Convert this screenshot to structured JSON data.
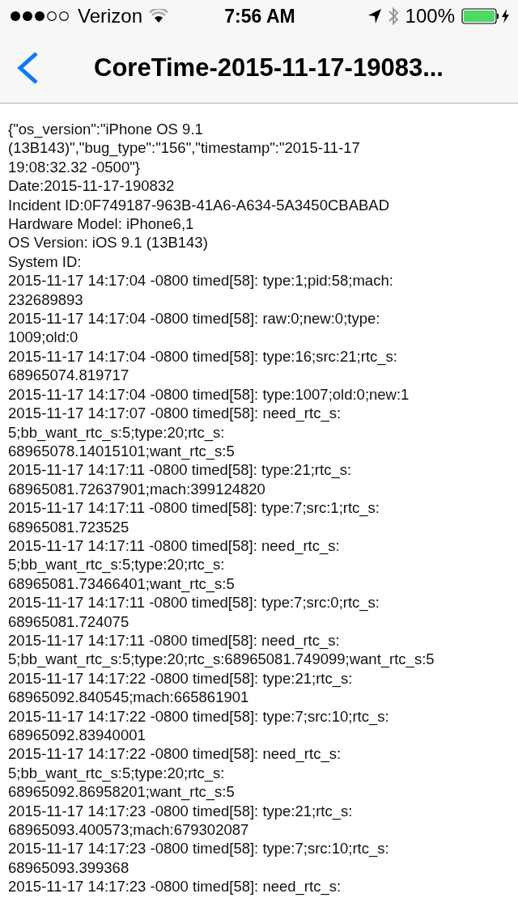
{
  "status_bar": {
    "carrier": "Verizon",
    "time": "7:56 AM",
    "battery": "100%"
  },
  "nav_bar": {
    "title": "CoreTime-2015-11-17-19083..."
  },
  "log_lines": [
    "{\"os_version\":\"iPhone OS 9.1",
    "(13B143)\",\"bug_type\":\"156\",\"timestamp\":\"2015-11-17",
    "19:08:32.32 -0500\"}",
    "Date:2015-11-17-190832",
    "Incident ID:0F749187-963B-41A6-A634-5A3450CBABAD",
    "Hardware Model: iPhone6,1",
    "OS Version: iOS 9.1 (13B143)",
    "System ID:",
    "2015-11-17 14:17:04 -0800 timed[58]: type:1;pid:58;mach:",
    "232689893",
    "2015-11-17 14:17:04 -0800 timed[58]: raw:0;new:0;type:",
    "1009;old:0",
    "2015-11-17 14:17:04 -0800 timed[58]: type:16;src:21;rtc_s:",
    "68965074.819717",
    "2015-11-17 14:17:04 -0800 timed[58]: type:1007;old:0;new:1",
    "2015-11-17 14:17:07 -0800 timed[58]: need_rtc_s:",
    "5;bb_want_rtc_s:5;type:20;rtc_s:",
    "68965078.14015101;want_rtc_s:5",
    "2015-11-17 14:17:11 -0800 timed[58]: type:21;rtc_s:",
    "68965081.72637901;mach:399124820",
    "2015-11-17 14:17:11 -0800 timed[58]: type:7;src:1;rtc_s:",
    "68965081.723525",
    "2015-11-17 14:17:11 -0800 timed[58]: need_rtc_s:",
    "5;bb_want_rtc_s:5;type:20;rtc_s:",
    "68965081.73466401;want_rtc_s:5",
    "2015-11-17 14:17:11 -0800 timed[58]: type:7;src:0;rtc_s:",
    "68965081.724075",
    "2015-11-17 14:17:11 -0800 timed[58]: need_rtc_s:",
    "5;bb_want_rtc_s:5;type:20;rtc_s:68965081.749099;want_rtc_s:5",
    "2015-11-17 14:17:22 -0800 timed[58]: type:21;rtc_s:",
    "68965092.840545;mach:665861901",
    "2015-11-17 14:17:22 -0800 timed[58]: type:7;src:10;rtc_s:",
    "68965092.83940001",
    "2015-11-17 14:17:22 -0800 timed[58]: need_rtc_s:",
    "5;bb_want_rtc_s:5;type:20;rtc_s:",
    "68965092.86958201;want_rtc_s:5",
    "2015-11-17 14:17:23 -0800 timed[58]: type:21;rtc_s:",
    "68965093.400573;mach:679302087",
    "2015-11-17 14:17:23 -0800 timed[58]: type:7;src:10;rtc_s:",
    "68965093.399368",
    "2015-11-17 14:17:23 -0800 timed[58]: need_rtc_s:"
  ]
}
